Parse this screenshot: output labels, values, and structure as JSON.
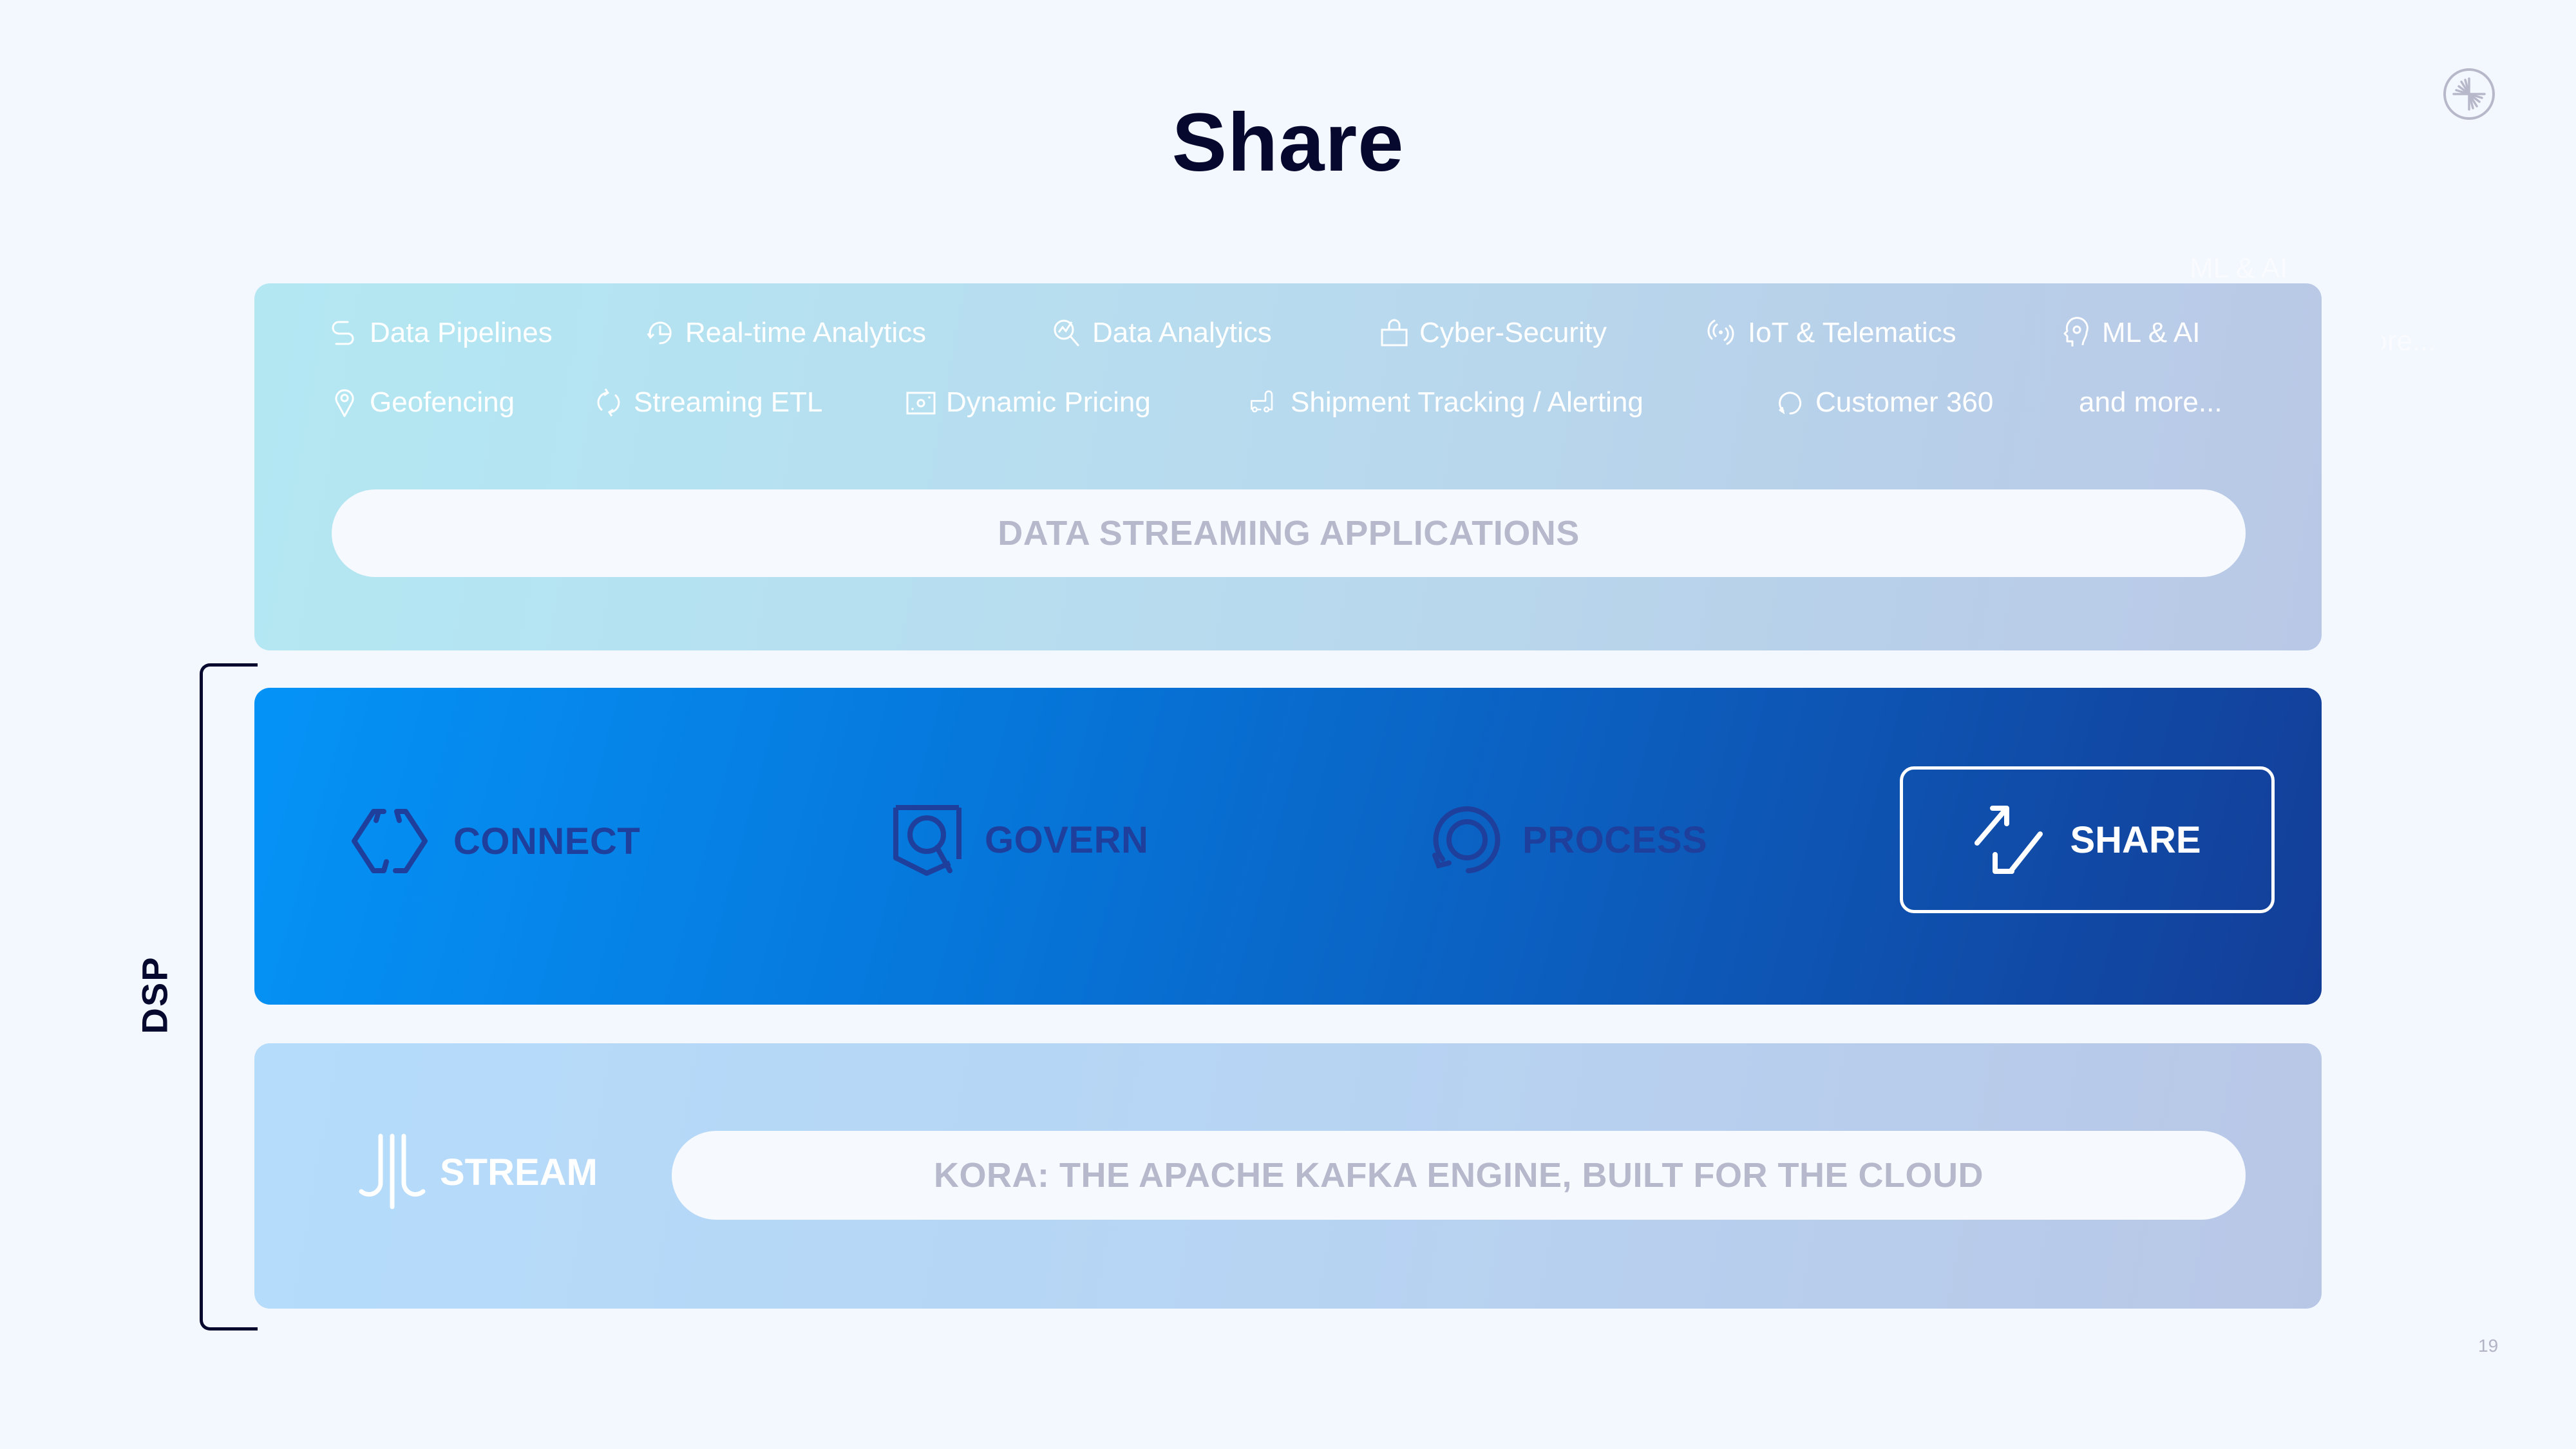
{
  "slide": {
    "title": "Share",
    "page_number": "19",
    "logo_icon": "confluent-logo-icon"
  },
  "applications": {
    "row1": [
      {
        "label": "Data Pipelines",
        "icon": "pipeline-icon"
      },
      {
        "label": "Real-time Analytics",
        "icon": "realtime-clock-icon"
      },
      {
        "label": "Data Analytics",
        "icon": "magnifier-chart-icon"
      },
      {
        "label": "Cyber-Security",
        "icon": "lock-icon"
      },
      {
        "label": "IoT & Telematics",
        "icon": "signal-icon"
      },
      {
        "label": "ML & AI",
        "icon": "head-brain-icon"
      }
    ],
    "row2": [
      {
        "label": "Geofencing",
        "icon": "map-pin-icon"
      },
      {
        "label": "Streaming ETL",
        "icon": "cycle-arrows-icon"
      },
      {
        "label": "Dynamic Pricing",
        "icon": "price-tag-icon"
      },
      {
        "label": "Shipment Tracking / Alerting",
        "icon": "truck-icon"
      },
      {
        "label": "Customer 360",
        "icon": "refresh-circle-icon"
      },
      {
        "label": "and more...",
        "icon": ""
      }
    ],
    "banner": "DATA STREAMING APPLICATIONS",
    "ghost_texts": [
      "ML & AI",
      "and more..."
    ]
  },
  "dsp": {
    "label": "DSP",
    "pillars": [
      {
        "label": "CONNECT",
        "icon": "hexagon-connect-icon",
        "active": false
      },
      {
        "label": "GOVERN",
        "icon": "shield-search-icon",
        "active": false
      },
      {
        "label": "PROCESS",
        "icon": "circular-process-icon",
        "active": false
      },
      {
        "label": "SHARE",
        "icon": "share-arrows-icon",
        "active": true
      }
    ],
    "stream": {
      "label": "STREAM",
      "icon": "stream-lines-icon",
      "banner": "KORA: THE APACHE KAFKA ENGINE, BUILT FOR THE CLOUD"
    }
  },
  "colors": {
    "title": "#06082e",
    "pillar_inactive": "#1e3f9c",
    "pillar_active": "#ffffff",
    "banner_text": "#b6b8cb",
    "dsp_gradient_start": "#0593f7",
    "dsp_gradient_end": "#133e98"
  }
}
